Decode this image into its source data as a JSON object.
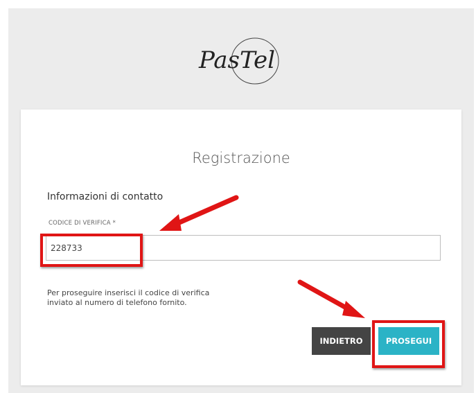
{
  "logo": {
    "text": "PasTel"
  },
  "card": {
    "title": "Registrazione",
    "section_title": "Informazioni di contatto"
  },
  "verification_field": {
    "label": "CODICE DI VERIFICA *",
    "value": "228733"
  },
  "hint": {
    "line1": "Per proseguire inserisci il codice di verifica",
    "line2": "inviato al numero di telefono fornito."
  },
  "buttons": {
    "back_label": "INDIETRO",
    "next_label": "PROSEGUI"
  },
  "colors": {
    "back_button": "#444444",
    "next_button": "#2bb3c6",
    "annotation": "#e01515",
    "page_background": "#ececec"
  }
}
